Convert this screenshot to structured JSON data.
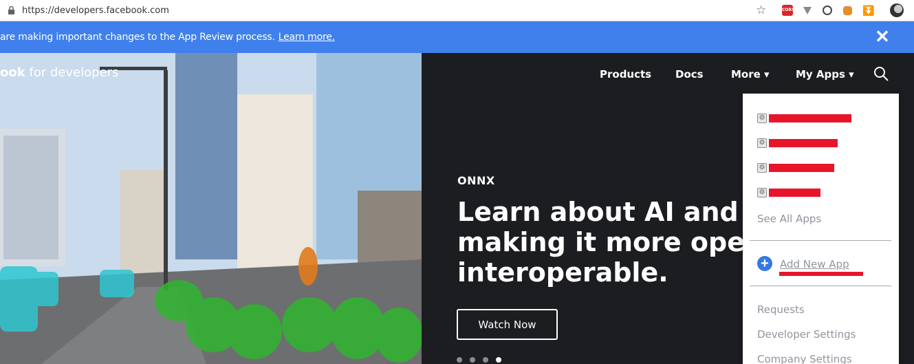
{
  "browser": {
    "url": "https://developers.facebook.com",
    "cors_badge": "CORS"
  },
  "banner": {
    "text": "are making important changes to the App Review process.",
    "link": "Learn more.",
    "close": "✕"
  },
  "brand": {
    "bold": "ook",
    "rest": " for developers"
  },
  "nav": {
    "products": "Products",
    "docs": "Docs",
    "more": "More ▾",
    "myapps": "My Apps ▾"
  },
  "hero": {
    "eyebrow": "ONNX",
    "headline": [
      "Learn about AI and hov",
      "making it more open ar",
      "interoperable."
    ],
    "cta": "Watch Now",
    "slides": 4,
    "active_slide": 4
  },
  "dropdown": {
    "see_all": "See All Apps",
    "add_new": "Add New App",
    "requests": "Requests",
    "developer_settings": "Developer Settings",
    "company_settings": "Company Settings"
  },
  "colors": {
    "banner": "#4080ec",
    "dark_bg": "#1c1d20",
    "redaction": "#e8152a",
    "add_icon": "#3578e5"
  }
}
